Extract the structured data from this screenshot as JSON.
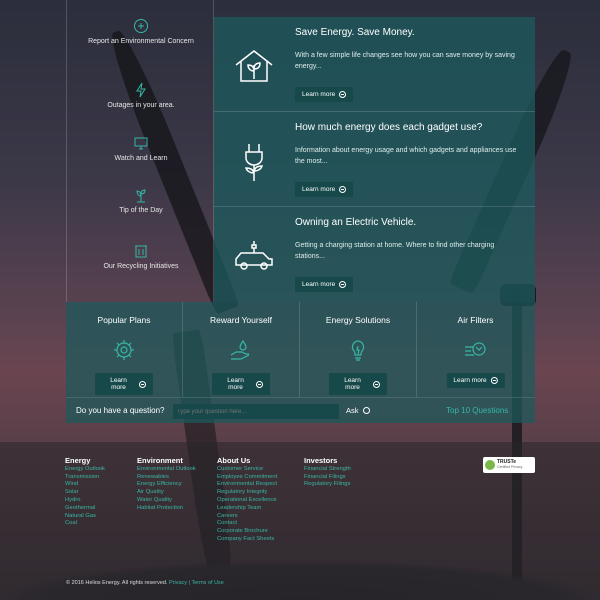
{
  "sidebar": {
    "items": [
      {
        "icon": "report-icon",
        "label": "Report an Environmental Concern"
      },
      {
        "icon": "lightning-icon",
        "label": "Outages in your area."
      },
      {
        "icon": "monitor-icon",
        "label": "Watch and Learn"
      },
      {
        "icon": "plant-icon",
        "label": "Tip of the Day"
      },
      {
        "icon": "recycle-bin-icon",
        "label": "Our Recycling Initiatives"
      }
    ]
  },
  "promos": [
    {
      "icon": "house-leaf-icon",
      "title": "Save Energy. Save Money.",
      "text": "With a few simple life changes see how you can save money by saving energy...",
      "button": "Learn more"
    },
    {
      "icon": "plug-plant-icon",
      "title": "How much energy does each gadget use?",
      "text": "Information about energy usage and which gadgets and appliances use the most...",
      "button": "Learn more"
    },
    {
      "icon": "electric-car-icon",
      "title": "Owning an Electric Vehicle.",
      "text": "Getting a charging station at home. Where to find other charging stations...",
      "button": "Learn more"
    }
  ],
  "tiles": [
    {
      "icon": "gear-plan-icon",
      "title": "Popular Plans",
      "button": "Learn more"
    },
    {
      "icon": "hand-drop-icon",
      "title": "Reward Yourself",
      "button": "Learn more"
    },
    {
      "icon": "bulb-icon",
      "title": "Energy Solutions",
      "button": "Learn more"
    },
    {
      "icon": "air-filter-icon",
      "title": "Air Filters",
      "button": "Learn more"
    }
  ],
  "question": {
    "label": "Do you have a question?",
    "placeholder": "Type your question here...",
    "ask": "Ask",
    "top10": "Top 10 Questions"
  },
  "footer": {
    "columns": [
      {
        "heading": "Energy",
        "links": [
          "Energy Outlook",
          "Transmission",
          "Wind",
          "Solar",
          "Hydro",
          "Geothermal",
          "Natural Gas",
          "Coal"
        ]
      },
      {
        "heading": "Environment",
        "links": [
          "Environmental Outlook",
          "Renewables",
          "Energy Efficiency",
          "Air Quality",
          "Water Quality",
          "Habitat Protection"
        ]
      },
      {
        "heading": "About Us",
        "links": [
          "Customer Service",
          "Employee Commitment",
          "Environmental Respect",
          "Regulatory Integrity",
          "Operational Excellence",
          "Leadership Team",
          "Careers",
          "Contact",
          "Corporate Brochure",
          "Company Fact Sheets"
        ]
      },
      {
        "heading": "Investors",
        "links": [
          "Financial Strength",
          "Financial Filings",
          "Regulatory Filings"
        ]
      }
    ],
    "truste": {
      "title": "TRUSTe",
      "sub": "Certified Privacy"
    },
    "copyright": "© 2016 Helios Energy. All rights reserved.",
    "privacy": "Privacy",
    "sep": "|",
    "terms": "Terms of Use"
  },
  "colors": {
    "accent": "#36b7a6",
    "panel": "#1c5a5c",
    "button": "#17484a"
  }
}
